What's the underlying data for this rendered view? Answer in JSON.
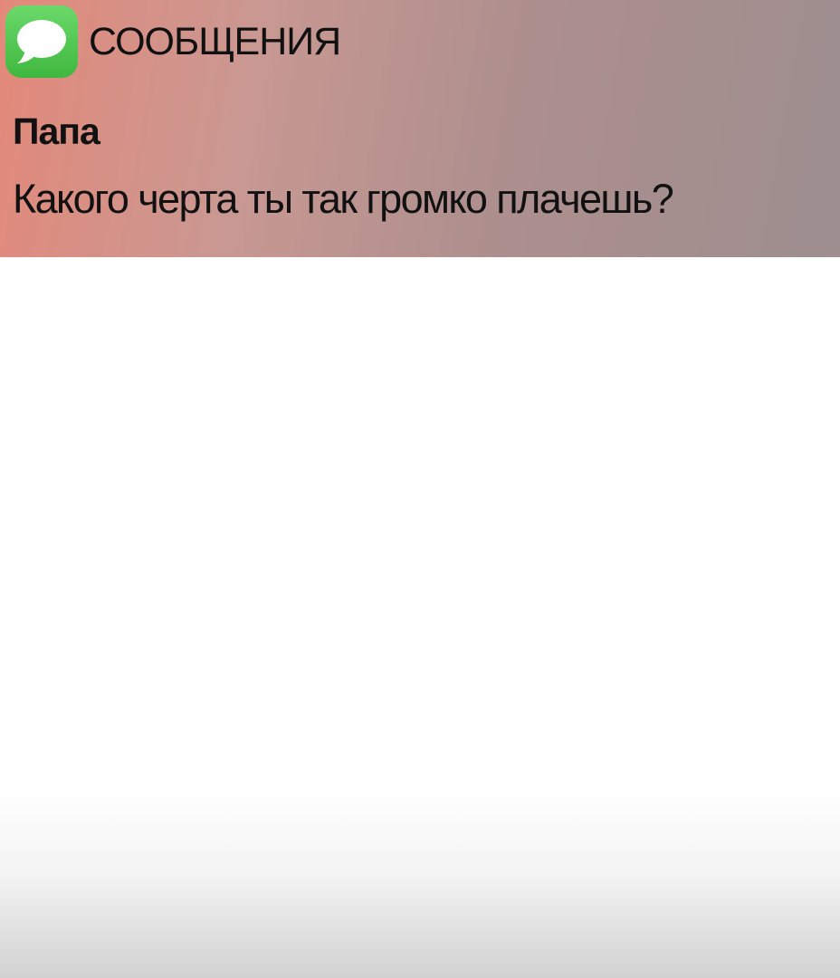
{
  "notification": {
    "app_icon": "messages-bubble-icon",
    "app_name": "СООБЩЕНИЯ",
    "sender": "Папа",
    "message": "Какого черта ты так громко плачешь?",
    "colors": {
      "icon_green": "#4cc94b",
      "banner_pink": "#e4897a",
      "banner_gray": "#9d8e8f",
      "text": "#111111"
    }
  }
}
